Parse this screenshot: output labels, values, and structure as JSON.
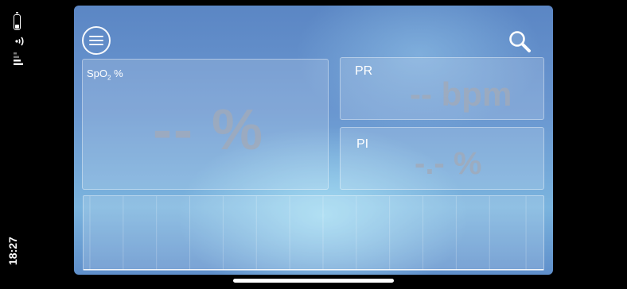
{
  "status": {
    "time": "18:27"
  },
  "spo2": {
    "label_main": "SpO",
    "label_sub": "2",
    "label_unit": " %",
    "value": "-- %"
  },
  "pr": {
    "label": "PR",
    "value": "-- bpm"
  },
  "pi": {
    "label": "PI",
    "value": "-.- %"
  },
  "icons": {
    "menu": "hamburger-menu-icon",
    "search": "magnifier-icon"
  }
}
